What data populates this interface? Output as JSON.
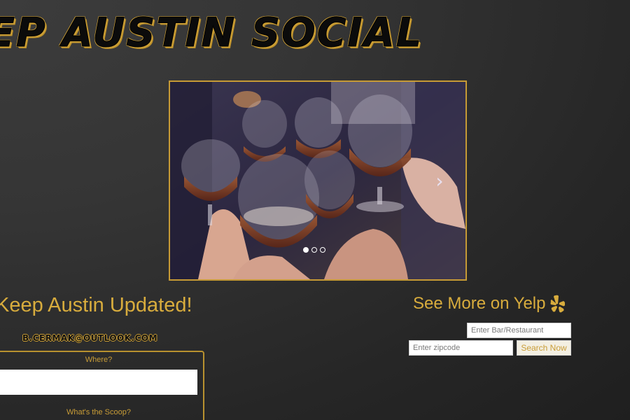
{
  "header": {
    "title": "EP AUSTIN SOCIAL"
  },
  "carousel": {
    "image_description": "hands toasting glasses of beer",
    "next_icon": "chevron-right-icon",
    "slide_count": 3,
    "active_slide": 1
  },
  "updates": {
    "heading": "Keep Austin Updated!",
    "email": "B.CERMAK@OUTLOOK.COM",
    "where_label": "Where?",
    "where_value": "",
    "scoop_label": "What's the Scoop?"
  },
  "yelp": {
    "heading": "See More on Yelp",
    "icon": "yelp-burst-icon",
    "bar_placeholder": "Enter Bar/Restaurant",
    "zip_placeholder": "Enter zipcode",
    "search_label": "Search Now"
  },
  "colors": {
    "accent": "#d4a93a",
    "background": "#333333"
  }
}
